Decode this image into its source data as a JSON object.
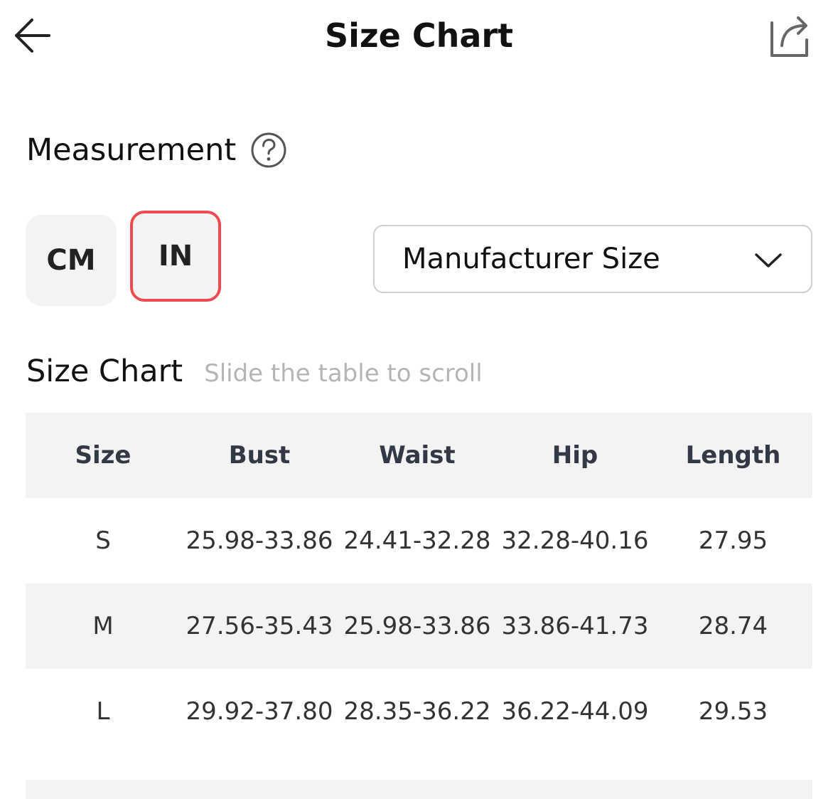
{
  "header": {
    "title": "Size Chart",
    "back_icon": "arrow-left-icon",
    "share_icon": "share-icon"
  },
  "measurement": {
    "label": "Measurement",
    "help_icon": "question-circle-icon"
  },
  "units": {
    "cm_label": "CM",
    "in_label": "IN",
    "selected": "IN",
    "selected_border_color": "#ef4a4f"
  },
  "size_select": {
    "value": "Manufacturer Size",
    "chevron_icon": "chevron-down-icon"
  },
  "size_chart": {
    "title": "Size Chart",
    "hint": "Slide the table to scroll",
    "columns": [
      "Size",
      "Bust",
      "Waist",
      "Hip",
      "Length"
    ],
    "rows": [
      [
        "S",
        "25.98-33.86",
        "24.41-32.28",
        "32.28-40.16",
        "27.95"
      ],
      [
        "M",
        "27.56-35.43",
        "25.98-33.86",
        "33.86-41.73",
        "28.74"
      ],
      [
        "L",
        "29.92-37.80",
        "28.35-36.22",
        "36.22-44.09",
        "29.53"
      ]
    ]
  }
}
